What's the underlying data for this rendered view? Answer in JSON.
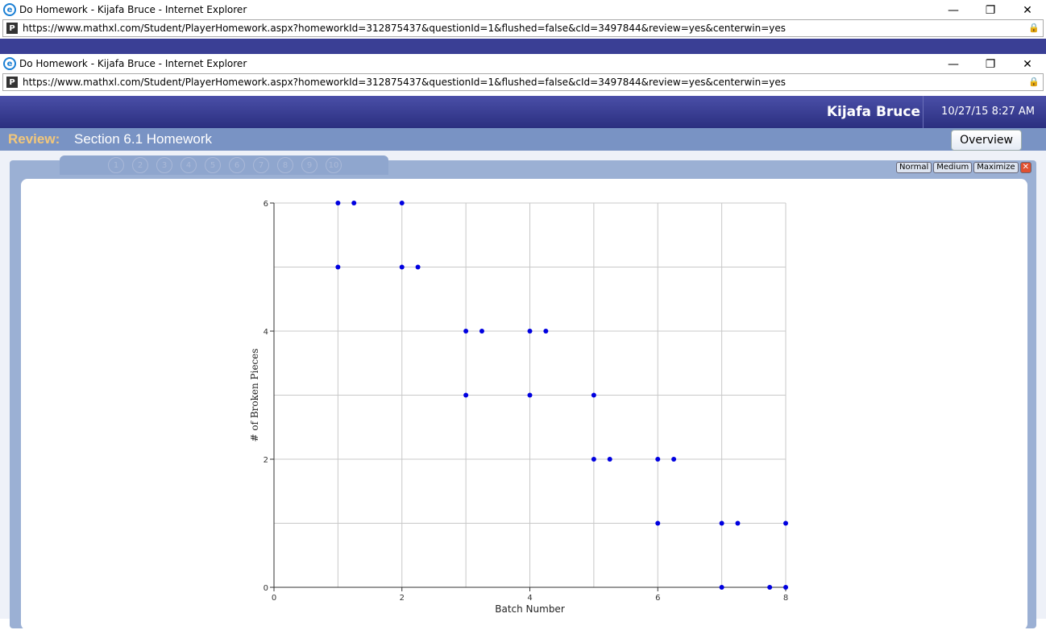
{
  "browser": {
    "title": "Do Homework - Kijafa Bruce - Internet Explorer",
    "url": "https://www.mathxl.com/Student/PlayerHomework.aspx?homeworkId=312875437&questionId=1&flushed=false&cId=3497844&review=yes&centerwin=yes"
  },
  "header": {
    "user": "Kijafa Bruce",
    "datetime": "10/27/15 8:27 AM"
  },
  "review": {
    "label": "Review:",
    "title": "Section 6.1 Homework",
    "overview": "Overview"
  },
  "nav": {
    "questions": [
      "1",
      "2",
      "3",
      "4",
      "5",
      "6",
      "7",
      "8",
      "9",
      "10"
    ]
  },
  "size_buttons": {
    "normal": "Normal",
    "medium": "Medium",
    "maximize": "Maximize"
  },
  "chart_data": {
    "type": "scatter",
    "xlabel": "Batch Number",
    "ylabel": "# of Broken Pieces",
    "xlim": [
      0,
      8
    ],
    "ylim": [
      0,
      6
    ],
    "xticks": [
      0,
      2,
      4,
      6,
      8
    ],
    "yticks": [
      0,
      2,
      4,
      6
    ],
    "grid": true,
    "point_color": "#0000e0",
    "points": [
      [
        1,
        6
      ],
      [
        1.25,
        6
      ],
      [
        2,
        6
      ],
      [
        1,
        5
      ],
      [
        2,
        5
      ],
      [
        2.25,
        5
      ],
      [
        3,
        4
      ],
      [
        3.25,
        4
      ],
      [
        4,
        4
      ],
      [
        4.25,
        4
      ],
      [
        3,
        3
      ],
      [
        4,
        3
      ],
      [
        5,
        3
      ],
      [
        5,
        2
      ],
      [
        5.25,
        2
      ],
      [
        6,
        2
      ],
      [
        6.25,
        2
      ],
      [
        6,
        1
      ],
      [
        7,
        1
      ],
      [
        7.25,
        1
      ],
      [
        8,
        1
      ],
      [
        7,
        0
      ],
      [
        7.75,
        0
      ],
      [
        8,
        0
      ]
    ]
  }
}
